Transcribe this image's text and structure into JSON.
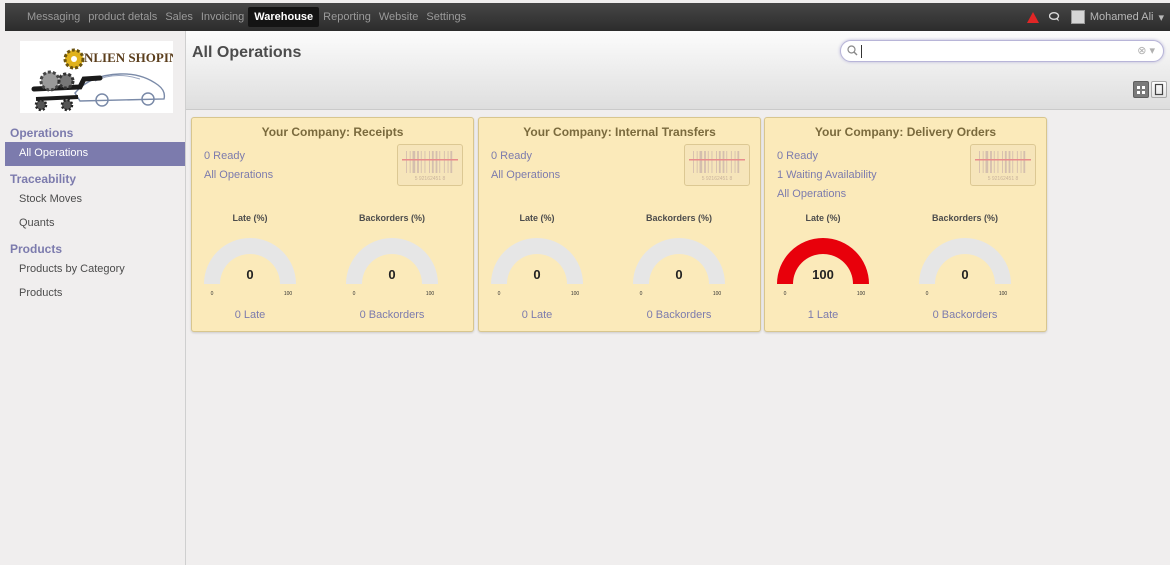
{
  "topbar": {
    "menus": [
      "Messaging",
      "product detals",
      "Sales",
      "Invoicing",
      "Warehouse",
      "Reporting",
      "Website",
      "Settings"
    ],
    "active_menu": "Warehouse",
    "user_name": "Mohamed Ali",
    "user_caret": "▾"
  },
  "logo_text": "NLIEN SHOPING",
  "sidebar": {
    "sections": [
      {
        "title": "Operations",
        "items": [
          {
            "label": "All Operations",
            "active": true
          }
        ]
      },
      {
        "title": "Traceability",
        "items": [
          {
            "label": "Stock Moves"
          },
          {
            "label": "Quants"
          }
        ]
      },
      {
        "title": "Products",
        "items": [
          {
            "label": "Products by Category"
          },
          {
            "label": "Products"
          }
        ]
      }
    ]
  },
  "page": {
    "title": "All Operations",
    "search_placeholder": "",
    "search_clear": "⊗ ▾"
  },
  "cards": [
    {
      "title": "Your Company: Receipts",
      "links": [
        "0 Ready",
        "All Operations"
      ],
      "late_label": "Late (%)",
      "backorders_label": "Backorders (%)",
      "late_value": 0,
      "backorders_value": 0,
      "gauge_min": "0",
      "gauge_max": "100",
      "late_foot": "0 Late",
      "backorders_foot": "0 Backorders",
      "barcode_text": "5 92162451 8"
    },
    {
      "title": "Your Company: Internal Transfers",
      "links": [
        "0 Ready",
        "All Operations"
      ],
      "late_label": "Late (%)",
      "backorders_label": "Backorders (%)",
      "late_value": 0,
      "backorders_value": 0,
      "gauge_min": "0",
      "gauge_max": "100",
      "late_foot": "0 Late",
      "backorders_foot": "0 Backorders",
      "barcode_text": "5 92162451 8"
    },
    {
      "title": "Your Company: Delivery Orders",
      "links": [
        "0 Ready",
        "1 Waiting Availability",
        "All Operations"
      ],
      "late_label": "Late (%)",
      "backorders_label": "Backorders (%)",
      "late_value": 100,
      "backorders_value": 0,
      "gauge_min": "0",
      "gauge_max": "100",
      "late_foot": "1 Late",
      "backorders_foot": "0 Backorders",
      "barcode_text": "5 92162451 8"
    }
  ],
  "colors": {
    "accent": "#7c7bad",
    "gauge_fill": "#e8000b",
    "gauge_empty": "#e6e6e6",
    "card_bg": "#fbeaba"
  }
}
